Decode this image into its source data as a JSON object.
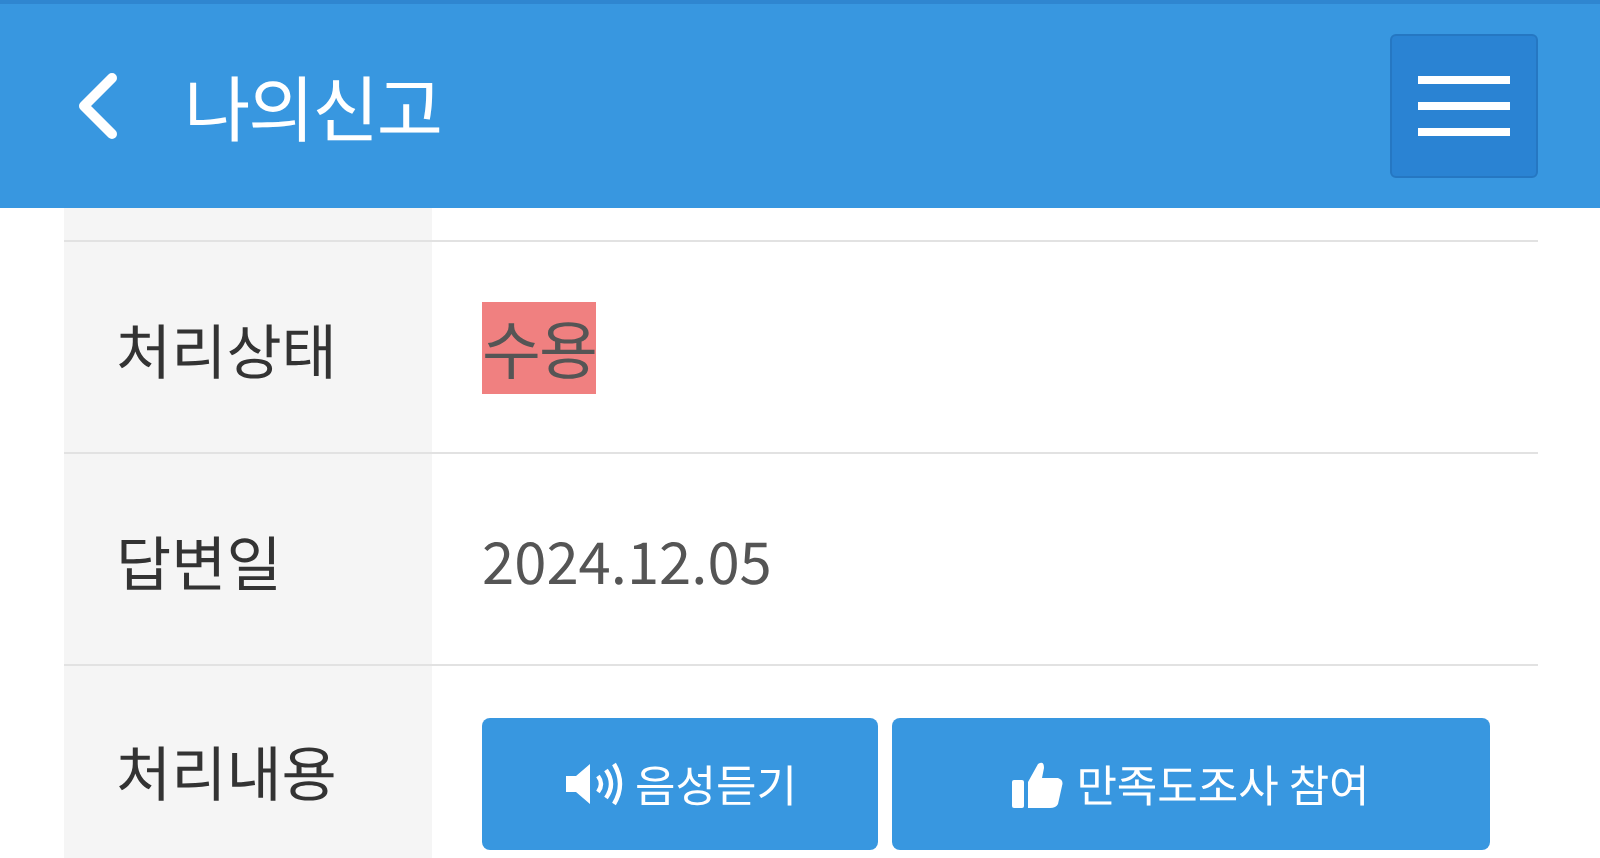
{
  "header": {
    "title": "나의신고"
  },
  "rows": [
    {
      "label": "처리상태",
      "kind": "status",
      "value": "수용",
      "highlighted": true
    },
    {
      "label": "답변일",
      "kind": "text",
      "value": "2024.12.05"
    },
    {
      "label": "처리내용",
      "kind": "buttons",
      "buttons": [
        {
          "label": "음성듣기",
          "kind": "speaker"
        },
        {
          "label": "만족도조사 참여",
          "kind": "thumb"
        }
      ]
    }
  ]
}
